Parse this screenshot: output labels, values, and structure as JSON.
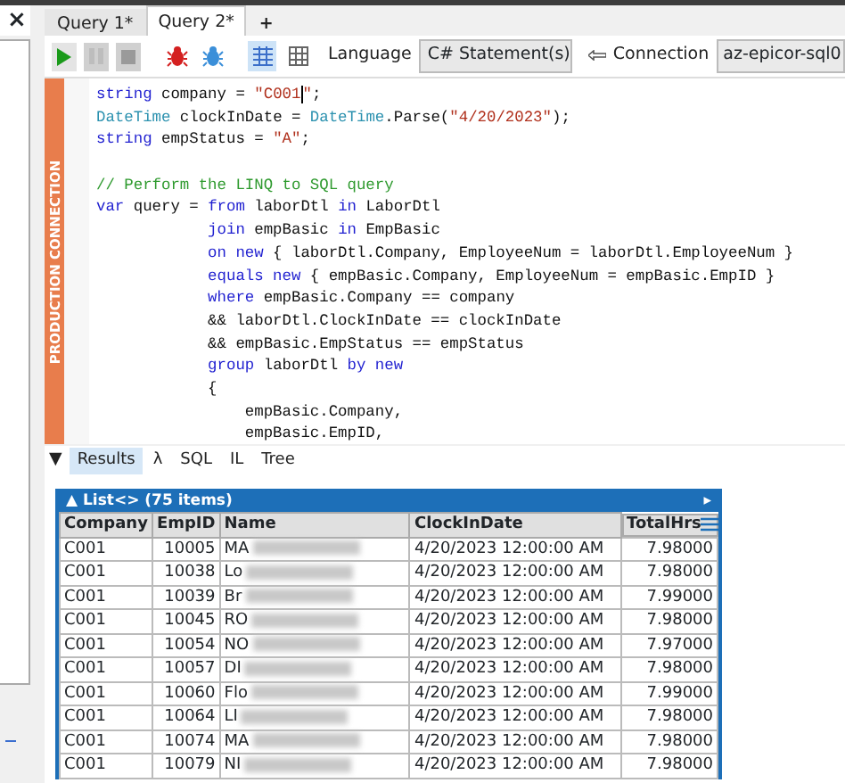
{
  "close_symbol": "×",
  "tabs": [
    {
      "label": "Query 1*",
      "selected": false
    },
    {
      "label": "Query 2*",
      "selected": true
    },
    {
      "label": "+",
      "selected": false
    }
  ],
  "toolbar": {
    "buttons": [
      {
        "kind": "run",
        "disabled": false
      },
      {
        "kind": "pause",
        "disabled": true
      },
      {
        "kind": "stop",
        "disabled": true
      },
      {
        "kind": "bug-red",
        "disabled": false
      },
      {
        "kind": "bug-blue",
        "disabled": false
      }
    ],
    "views": [
      {
        "kind": "rows",
        "selected": true
      },
      {
        "kind": "grid",
        "selected": false
      }
    ],
    "language_label": "Language",
    "language_value": "C# Statement(s)",
    "connection_label": "Connection",
    "connection_value": "az-epicor-sql0"
  },
  "connection_banner": "PRODUCTION CONNECTION",
  "code_lines": [
    [
      {
        "kind": "keyword",
        "text": "string"
      },
      {
        "kind": "plain",
        "text": " company = "
      },
      {
        "kind": "string",
        "text": "\"C001"
      },
      {
        "kind": "cursor",
        "text": "\""
      },
      {
        "kind": "plain",
        "text": ";"
      }
    ],
    [
      {
        "kind": "type",
        "text": "DateTime"
      },
      {
        "kind": "plain",
        "text": " clockInDate = "
      },
      {
        "kind": "type",
        "text": "DateTime"
      },
      {
        "kind": "plain",
        "text": ".Parse("
      },
      {
        "kind": "string",
        "text": "\"4/20/2023\""
      },
      {
        "kind": "plain",
        "text": ");"
      }
    ],
    [
      {
        "kind": "keyword",
        "text": "string"
      },
      {
        "kind": "plain",
        "text": " empStatus = "
      },
      {
        "kind": "string",
        "text": "\"A\""
      },
      {
        "kind": "plain",
        "text": ";"
      }
    ],
    {
      "kind": "blank"
    },
    [
      {
        "kind": "comment",
        "text": "// Perform the LINQ to SQL query"
      }
    ],
    [
      {
        "kind": "keyword",
        "text": "var"
      },
      {
        "kind": "plain",
        "text": " query = "
      },
      {
        "kind": "keyword",
        "text": "from"
      },
      {
        "kind": "plain",
        "text": " laborDtl "
      },
      {
        "kind": "keyword",
        "text": "in"
      },
      {
        "kind": "plain",
        "text": " LaborDtl"
      }
    ],
    [
      {
        "kind": "keyword",
        "text": "            join"
      },
      {
        "kind": "plain",
        "text": " empBasic "
      },
      {
        "kind": "keyword",
        "text": "in"
      },
      {
        "kind": "plain",
        "text": " EmpBasic"
      }
    ],
    [
      {
        "kind": "keyword",
        "text": "            on new"
      },
      {
        "kind": "plain",
        "text": " { laborDtl.Company, EmployeeNum = laborDtl.EmployeeNum }"
      }
    ],
    [
      {
        "kind": "keyword",
        "text": "            equals new"
      },
      {
        "kind": "plain",
        "text": " { empBasic.Company, EmployeeNum = empBasic.EmpID }"
      }
    ],
    [
      {
        "kind": "keyword",
        "text": "            where"
      },
      {
        "kind": "plain",
        "text": " empBasic.Company == company"
      }
    ],
    [
      {
        "kind": "plain",
        "text": "            && laborDtl.ClockInDate == clockInDate"
      }
    ],
    [
      {
        "kind": "plain",
        "text": "            && empBasic.EmpStatus == empStatus"
      }
    ],
    [
      {
        "kind": "keyword",
        "text": "            group"
      },
      {
        "kind": "plain",
        "text": " laborDtl "
      },
      {
        "kind": "keyword",
        "text": "by new"
      }
    ],
    [
      {
        "kind": "plain",
        "text": "            {"
      }
    ],
    [
      {
        "kind": "plain",
        "text": "                empBasic.Company,"
      }
    ],
    [
      {
        "kind": "plain",
        "text": "                empBasic.EmpID,"
      }
    ]
  ],
  "collapse_symbol": "▼",
  "result_tabs": [
    {
      "label": "Results",
      "selected": true
    },
    {
      "label": "λ",
      "selected": false
    },
    {
      "label": "SQL",
      "selected": false
    },
    {
      "label": "IL",
      "selected": false
    },
    {
      "label": "Tree",
      "selected": false
    }
  ],
  "table": {
    "title": "▲ List<> (75 items)",
    "expand_symbol": "▸",
    "columns": [
      "Company",
      "EmpID",
      "Name",
      "ClockInDate",
      "TotalHrs"
    ],
    "rows": [
      [
        "C001",
        "10005",
        "MA",
        "4/20/2023 12:00:00 AM",
        "7.98000"
      ],
      [
        "C001",
        "10038",
        "Lo",
        "4/20/2023 12:00:00 AM",
        "7.98000"
      ],
      [
        "C001",
        "10039",
        "Br",
        "4/20/2023 12:00:00 AM",
        "7.99000"
      ],
      [
        "C001",
        "10045",
        "RO",
        "4/20/2023 12:00:00 AM",
        "7.98000"
      ],
      [
        "C001",
        "10054",
        "NO",
        "4/20/2023 12:00:00 AM",
        "7.97000"
      ],
      [
        "C001",
        "10057",
        "DI",
        "4/20/2023 12:00:00 AM",
        "7.98000"
      ],
      [
        "C001",
        "10060",
        "Flo",
        "4/20/2023 12:00:00 AM",
        "7.99000"
      ],
      [
        "C001",
        "10064",
        "LI",
        "4/20/2023 12:00:00 AM",
        "7.98000"
      ],
      [
        "C001",
        "10074",
        "MA",
        "4/20/2023 12:00:00 AM",
        "7.98000"
      ],
      [
        "C001",
        "10079",
        "NI",
        "4/20/2023 12:00:00 AM",
        "7.98000"
      ]
    ]
  }
}
